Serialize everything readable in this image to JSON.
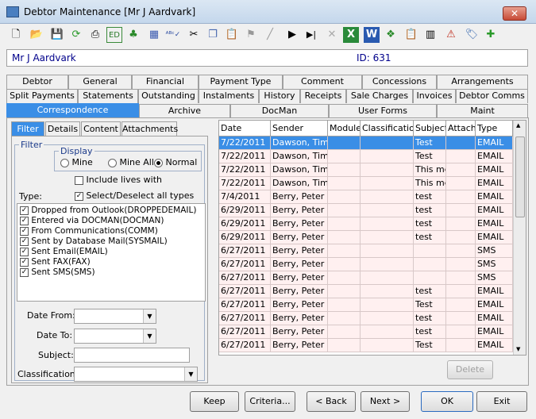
{
  "window": {
    "title": "Debtor Maintenance  [Mr J Aardvark]",
    "close": "✕"
  },
  "header": {
    "name": "Mr J Aardvark",
    "id_label": "ID: 631"
  },
  "tabs_row1": [
    "Debtor",
    "General",
    "Financial",
    "Payment Type",
    "Comment",
    "Concessions",
    "Arrangements"
  ],
  "tabs_row2": [
    "Split Payments",
    "Statements",
    "Outstanding",
    "Instalments",
    "History",
    "Receipts",
    "Sale Charges",
    "Invoices",
    "Debtor Comms"
  ],
  "tabs_row3": [
    "Correspondence",
    "Archive",
    "DocMan",
    "User Forms",
    "Maint"
  ],
  "subtabs": [
    "Filter",
    "Details",
    "Content",
    "Attachments"
  ],
  "filter": {
    "group_label": "Filter",
    "display_label": "Display",
    "radio_mine": "Mine",
    "radio_mine_all": "Mine All",
    "radio_normal": "Normal",
    "include_lives": "Include lives with",
    "type_label": "Type:",
    "select_all": "Select/Deselect all types",
    "types": [
      "Dropped from Outlook(DROPPEDEMAIL)",
      "Entered via DOCMAN(DOCMAN)",
      "From Communications(COMM)",
      "Sent by Database Mail(SYSMAIL)",
      "Sent Email(EMAIL)",
      "Sent FAX(FAX)",
      "Sent SMS(SMS)"
    ],
    "date_from": "Date From:",
    "date_to": "Date To:",
    "subject": "Subject:",
    "classification": "Classification:"
  },
  "grid": {
    "columns": [
      "Date",
      "Sender",
      "Module",
      "Classification",
      "Subject",
      "Attach",
      "Type"
    ],
    "rows": [
      [
        "7/22/2011",
        "Dawson, Timot",
        "",
        "",
        "Test",
        "",
        "EMAIL"
      ],
      [
        "7/22/2011",
        "Dawson, Timot",
        "",
        "",
        "Test",
        "",
        "EMAIL"
      ],
      [
        "7/22/2011",
        "Dawson, Timot",
        "",
        "",
        "This mes",
        "",
        "EMAIL"
      ],
      [
        "7/22/2011",
        "Dawson, Timot",
        "",
        "",
        "This mes",
        "",
        "EMAIL"
      ],
      [
        "7/4/2011",
        "Berry, Peter",
        "",
        "",
        "test",
        "",
        "EMAIL"
      ],
      [
        "6/29/2011",
        "Berry, Peter",
        "",
        "",
        "test",
        "",
        "EMAIL"
      ],
      [
        "6/29/2011",
        "Berry, Peter",
        "",
        "",
        "test",
        "",
        "EMAIL"
      ],
      [
        "6/29/2011",
        "Berry, Peter",
        "",
        "",
        "test",
        "",
        "EMAIL"
      ],
      [
        "6/27/2011",
        "Berry, Peter",
        "",
        "",
        "",
        "",
        "SMS"
      ],
      [
        "6/27/2011",
        "Berry, Peter",
        "",
        "",
        "",
        "",
        "SMS"
      ],
      [
        "6/27/2011",
        "Berry, Peter",
        "",
        "",
        "",
        "",
        "SMS"
      ],
      [
        "6/27/2011",
        "Berry, Peter",
        "",
        "",
        "test",
        "",
        "EMAIL"
      ],
      [
        "6/27/2011",
        "Berry, Peter",
        "",
        "",
        "Test",
        "",
        "EMAIL"
      ],
      [
        "6/27/2011",
        "Berry, Peter",
        "",
        "",
        "test",
        "",
        "EMAIL"
      ],
      [
        "6/27/2011",
        "Berry, Peter",
        "",
        "",
        "test",
        "",
        "EMAIL"
      ],
      [
        "6/27/2011",
        "Berry, Peter",
        "",
        "",
        "Test",
        "",
        "EMAIL"
      ]
    ]
  },
  "buttons": {
    "delete": "Delete",
    "keep": "Keep",
    "criteria": "Criteria...",
    "back": "< Back",
    "next": "Next >",
    "ok": "OK",
    "exit": "Exit"
  },
  "toolbar_icons": [
    "new-icon",
    "open-icon",
    "save-icon",
    "refresh-icon",
    "print-icon",
    "edit-icon",
    "tree-icon",
    "calculator-icon",
    "spellcheck-icon",
    "cut-icon",
    "copy-icon",
    "paste-icon",
    "flag-icon",
    "line-icon",
    "play-icon",
    "next-end-icon",
    "delete-icon",
    "excel-icon",
    "word-icon",
    "network-icon",
    "clipboard-icon",
    "barcode-icon",
    "alert-icon",
    "tag-icon",
    "add-doc-icon"
  ]
}
